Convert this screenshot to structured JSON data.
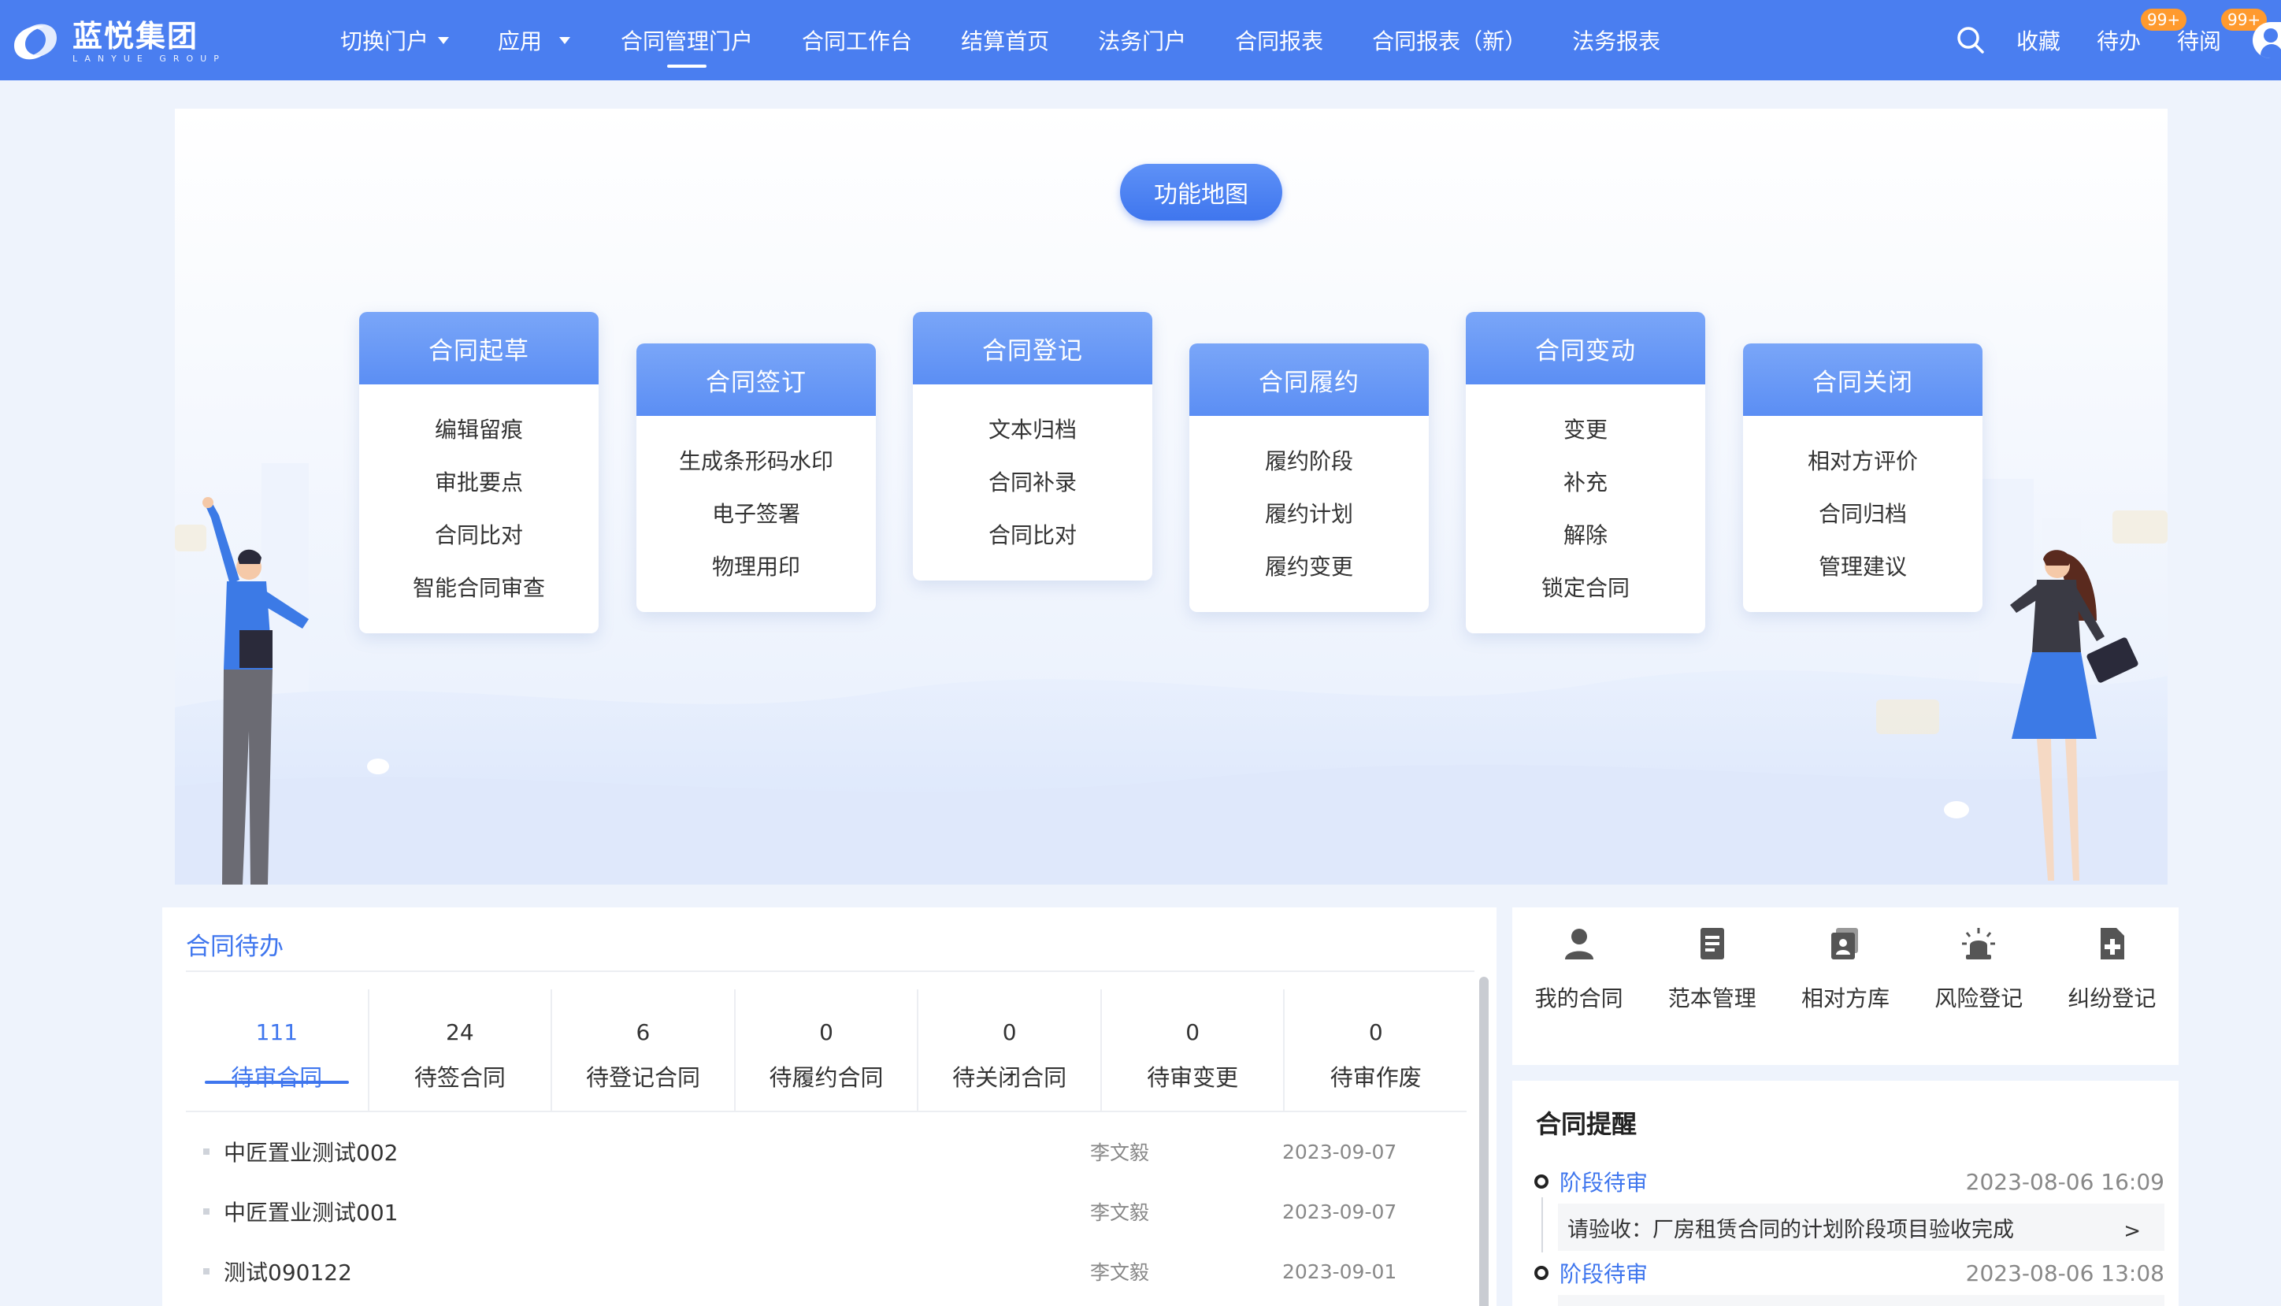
{
  "header": {
    "logo_cn": "蓝悦集团",
    "logo_en": "LANYUE GROUP",
    "nav": [
      {
        "label": "切换门户",
        "dropdown": true
      },
      {
        "label": "应用",
        "dropdown": true
      },
      {
        "label": "合同管理门户",
        "active": true
      },
      {
        "label": "合同工作台"
      },
      {
        "label": "结算首页"
      },
      {
        "label": "法务门户"
      },
      {
        "label": "合同报表"
      },
      {
        "label": "合同报表（新）"
      },
      {
        "label": "法务报表"
      }
    ],
    "favorites": "收藏",
    "todo": "待办",
    "todo_badge": "99+",
    "toread": "待阅",
    "toread_badge": "99+",
    "accent": "#4a7ef0",
    "badge_color": "#ff9a2e"
  },
  "map": {
    "title": "功能地图",
    "cards": [
      {
        "title": "合同起草",
        "items": [
          "编辑留痕",
          "审批要点",
          "合同比对",
          "智能合同审查"
        ]
      },
      {
        "title": "合同签订",
        "items": [
          "生成条形码水印",
          "电子签署",
          "物理用印"
        ]
      },
      {
        "title": "合同登记",
        "items": [
          "文本归档",
          "合同补录",
          "合同比对"
        ]
      },
      {
        "title": "合同履约",
        "items": [
          "履约阶段",
          "履约计划",
          "履约变更"
        ]
      },
      {
        "title": "合同变动",
        "items": [
          "变更",
          "补充",
          "解除",
          "锁定合同"
        ]
      },
      {
        "title": "合同关闭",
        "items": [
          "相对方评价",
          "合同归档",
          "管理建议"
        ]
      }
    ]
  },
  "todo": {
    "title": "合同待办",
    "tabs": [
      {
        "count": "111",
        "label": "待审合同",
        "active": true
      },
      {
        "count": "24",
        "label": "待签合同"
      },
      {
        "count": "6",
        "label": "待登记合同"
      },
      {
        "count": "0",
        "label": "待履约合同"
      },
      {
        "count": "0",
        "label": "待关闭合同"
      },
      {
        "count": "0",
        "label": "待审变更"
      },
      {
        "count": "0",
        "label": "待审作废"
      }
    ],
    "rows": [
      {
        "name": "中匠置业测试002",
        "person": "李文毅",
        "date": "2023-09-07"
      },
      {
        "name": "中匠置业测试001",
        "person": "李文毅",
        "date": "2023-09-07"
      },
      {
        "name": "测试090122",
        "person": "李文毅",
        "date": "2023-09-01"
      }
    ]
  },
  "shortcuts": [
    {
      "label": "我的合同",
      "icon": "user-icon"
    },
    {
      "label": "范本管理",
      "icon": "document-list-icon"
    },
    {
      "label": "相对方库",
      "icon": "contact-card-icon"
    },
    {
      "label": "风险登记",
      "icon": "alarm-light-icon"
    },
    {
      "label": "纠纷登记",
      "icon": "file-plus-icon"
    }
  ],
  "reminders": {
    "title": "合同提醒",
    "items": [
      {
        "type": "阶段待审",
        "time": "2023-08-06 16:09",
        "text": "请验收：厂房租赁合同的计划阶段项目验收完成",
        "arrow": ">"
      },
      {
        "type": "阶段待审",
        "time": "2023-08-06 13:08",
        "text": ""
      }
    ]
  }
}
